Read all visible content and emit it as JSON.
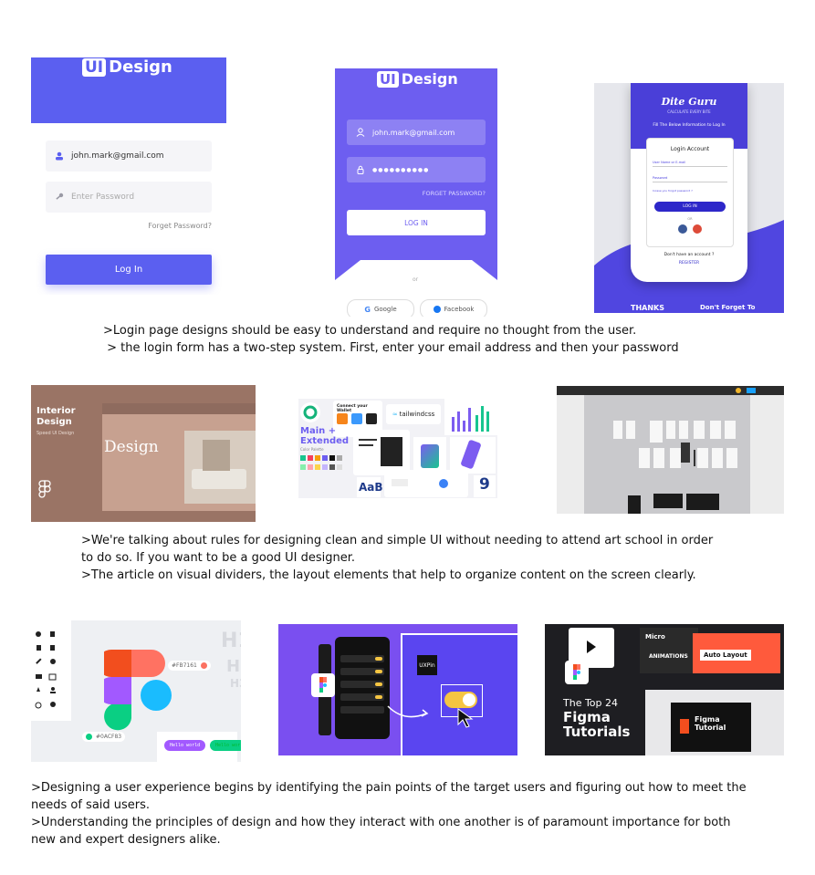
{
  "row1": {
    "tile1": {
      "logo_box": "UI",
      "logo_word": "Design",
      "email": "john.mark@gmail.com",
      "password_placeholder": "Enter Password",
      "forgot": "Forget Password?",
      "login": "Log In"
    },
    "tile2": {
      "logo_box": "UI",
      "logo_word": "Design",
      "email": "john.mark@gmail.com",
      "password": "●●●●●●●●●●",
      "forgot": "FORGET PASSWORD?",
      "login": "LOG IN",
      "or": "or",
      "google": "Google",
      "facebook": "Facebook"
    },
    "tile3": {
      "brand": "Dite Guru",
      "tagline": "CALCULATE EVERY BITE",
      "instruction": "Fill The Below Information to Log In",
      "card_title": "Login Account",
      "user_field": "User Name or E-mail",
      "password_field": "Password",
      "forgot": "Incase you forgot password ?",
      "login": "LOG IN",
      "or": "OR",
      "no_account": "Don't have an account ?",
      "register": "REGISTER",
      "thanks": "THANKS",
      "dont_forget": "Don't Forget To"
    },
    "caption": ">Login page designs should be easy to understand and require no thought from the user.\n > the login form has a two-step system. First, enter your email address and then your password"
  },
  "row2": {
    "tile4": {
      "title": "Interior\nDesign",
      "subtitle": "Speed UI Design",
      "hero": "Design"
    },
    "tile5": {
      "wallet": "Connect your Wallet",
      "tailwind": "tailwindcss",
      "palette_title": "Main +\nExtended",
      "palette_sub": "Color Palette",
      "aab": "AaB",
      "num": "9"
    },
    "tile6": {},
    "caption": ">We're talking about rules for designing clean and simple UI without needing to attend art school in order\nto do so. If you want to be a good UI designer.\n>The article on visual dividers, the layout elements that help to organize content on the screen clearly."
  },
  "row3": {
    "tile7": {
      "h1": "H1",
      "h2": "H2",
      "h3": "H3",
      "color1": "#FB7161",
      "color2": "#0ACF83",
      "pill1": "Hello world",
      "pill2": "Hello wor"
    },
    "tile8": {
      "uxpin": "UXPin"
    },
    "tile9": {
      "micro": "Micro",
      "animations": "ANIMATIONS",
      "auto_layout": "Auto Layout",
      "top24": "The Top 24",
      "figma": "Figma",
      "tutorials": "Tutorials",
      "figma_tutorial": "Figma\nTutorial"
    },
    "caption": ">Designing a user experience begins by identifying the pain points of the target users and figuring out how to meet the\nneeds of said users.\n>Understanding the principles of design and how they interact with one another is of paramount importance for both\nnew and expert designers alike."
  },
  "colors": {
    "primary_purple": "#5b5ff0",
    "figma_red": "#f24e1e",
    "figma_purple": "#a259ff",
    "figma_blue": "#1abcfe",
    "figma_green": "#0acf83"
  }
}
